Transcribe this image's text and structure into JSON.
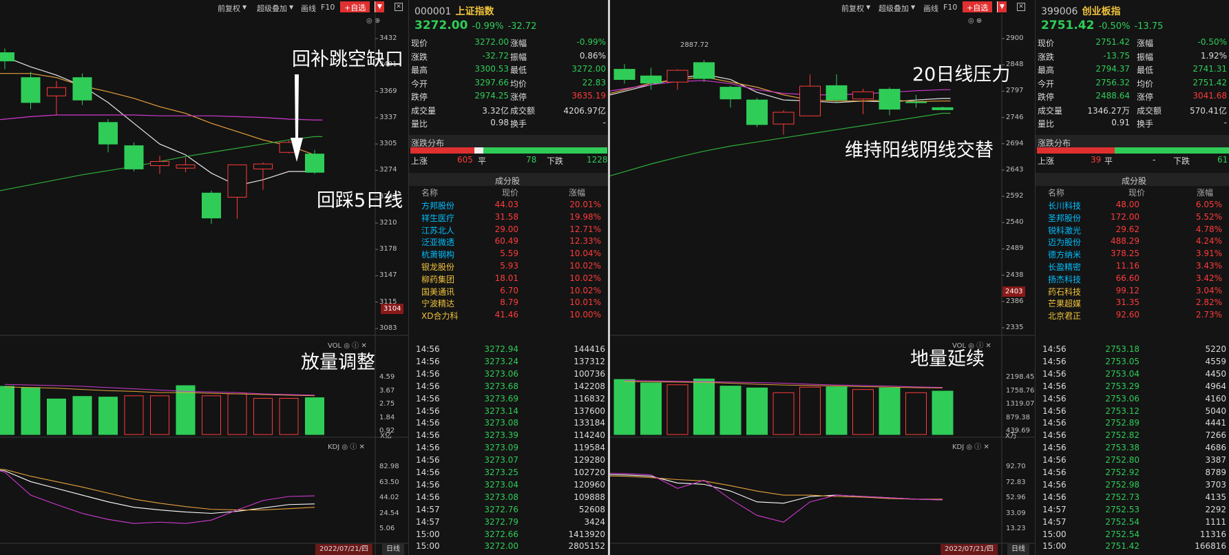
{
  "left": {
    "toolbar": {
      "adjust": "前复权",
      "overlay": "超级叠加",
      "draw": "画线",
      "f10": "F10",
      "fav": "+自选"
    },
    "price_axis": [
      "3432",
      "3401",
      "3369",
      "3337",
      "3305",
      "3274",
      "3242",
      "3210",
      "3178",
      "3147",
      "3115",
      "3083"
    ],
    "current_price_label": "3104",
    "vol_label": "VOL",
    "vol_axis": [
      "4.59",
      "3.67",
      "2.75",
      "1.84",
      "0.92"
    ],
    "vol_unit": "X亿",
    "kdj_label": "KDJ",
    "kdj_axis": [
      "82.98",
      "63.50",
      "44.02",
      "24.54",
      "5.06"
    ],
    "date": "2022/07/21/四",
    "period": "日线",
    "annotations": {
      "gap": "回补跳空缺口",
      "ma5": "回踩5日线",
      "vol": "放量调整"
    },
    "candles": [
      {
        "o": 3415,
        "c": 3405,
        "h": 3420,
        "l": 3395
      },
      {
        "o": 3385,
        "c": 3355,
        "h": 3392,
        "l": 3347
      },
      {
        "o": 3363,
        "c": 3373,
        "h": 3381,
        "l": 3340
      },
      {
        "o": 3385,
        "c": 3358,
        "h": 3390,
        "l": 3352
      },
      {
        "o": 3331,
        "c": 3305,
        "h": 3335,
        "l": 3295
      },
      {
        "o": 3303,
        "c": 3275,
        "h": 3307,
        "l": 3272
      },
      {
        "o": 3279,
        "c": 3284,
        "h": 3291,
        "l": 3269
      },
      {
        "o": 3276,
        "c": 3280,
        "h": 3289,
        "l": 3271
      },
      {
        "o": 3246,
        "c": 3216,
        "h": 3249,
        "l": 3209
      },
      {
        "o": 3241,
        "c": 3280,
        "h": 3280,
        "l": 3215
      },
      {
        "o": 3275,
        "c": 3281,
        "h": 3283,
        "l": 3250
      },
      {
        "o": 3295,
        "c": 3307,
        "h": 3309,
        "l": 3294
      },
      {
        "o": 3293,
        "c": 3271,
        "h": 3298,
        "l": 3269
      }
    ],
    "ma": {
      "ma5": [
        3410,
        3398,
        3388,
        3375,
        3355,
        3330,
        3305,
        3292,
        3270,
        3255,
        3262,
        3272,
        3272
      ],
      "ma10": [
        3390,
        3390,
        3385,
        3375,
        3368,
        3360,
        3350,
        3342,
        3330,
        3320,
        3310,
        3303,
        3292
      ],
      "ma20": [
        3335,
        3338,
        3340,
        3340,
        3340,
        3340,
        3339,
        3339,
        3339,
        3338,
        3337,
        3335,
        3334
      ],
      "ma60": [
        3250,
        3256,
        3262,
        3268,
        3273,
        3278,
        3284,
        3290,
        3295,
        3300,
        3305,
        3310,
        3314
      ]
    },
    "volume": {
      "bars": [
        {
          "v": 3.8,
          "up": false
        },
        {
          "v": 3.7,
          "up": false
        },
        {
          "v": 2.8,
          "up": false
        },
        {
          "v": 3.0,
          "up": false
        },
        {
          "v": 2.95,
          "up": false
        },
        {
          "v": 3.05,
          "up": true
        },
        {
          "v": 3.05,
          "up": true
        },
        {
          "v": 3.85,
          "up": false
        },
        {
          "v": 3.05,
          "up": true
        },
        {
          "v": 3.2,
          "up": true
        },
        {
          "v": 2.85,
          "up": true
        },
        {
          "v": 2.85,
          "up": true
        },
        {
          "v": 2.9,
          "up": false
        }
      ],
      "ma1": [
        3.75,
        3.7,
        3.65,
        3.55,
        3.45,
        3.4,
        3.3,
        3.3,
        3.25,
        3.2,
        3.15,
        3.1,
        3.05
      ],
      "ma2": [
        3.95,
        3.9,
        3.85,
        3.8,
        3.7,
        3.6,
        3.5,
        3.4,
        3.35,
        3.3,
        3.2,
        3.15,
        3.1
      ]
    },
    "kdj": {
      "k": [
        88,
        72,
        62,
        52,
        42,
        34,
        30,
        27,
        25,
        28,
        33,
        38,
        39
      ],
      "d": [
        90,
        80,
        72,
        64,
        55,
        46,
        40,
        35,
        31,
        30,
        30,
        32,
        34
      ],
      "j": [
        86,
        52,
        38,
        25,
        16,
        10,
        12,
        10,
        15,
        30,
        44,
        50,
        51
      ]
    }
  },
  "info1": {
    "code": "000001",
    "name": "上证指数",
    "price": "3272.00",
    "pct": "-0.99%",
    "chg": "-32.72",
    "rows": [
      [
        "现价",
        "3272.00",
        "涨幅",
        "-0.99%"
      ],
      [
        "涨跌",
        "-32.72",
        "振幅",
        "0.86%"
      ],
      [
        "最高",
        "3300.53",
        "最低",
        "3272.00"
      ],
      [
        "今开",
        "3297.66",
        "均价",
        "22.83"
      ],
      [
        "跌停",
        "2974.25",
        "涨停",
        "3635.19"
      ],
      [
        "成交量",
        "3.32亿",
        "成交额",
        "4206.97亿"
      ],
      [
        "量比",
        "0.98",
        "换手",
        "-"
      ]
    ],
    "dist_title": "涨跌分布",
    "up_label": "上涨",
    "up": "605",
    "flat_label": "平",
    "flat": "78",
    "down_label": "下跌",
    "down": "1228",
    "comp_title": "成分股",
    "comp_headers": [
      "名称",
      "现价",
      "涨幅"
    ],
    "comps": [
      [
        "方邦股份",
        "44.03",
        "20.01%"
      ],
      [
        "祥生医疗",
        "31.58",
        "19.98%"
      ],
      [
        "江苏北人",
        "29.00",
        "12.71%"
      ],
      [
        "泛亚微透",
        "60.49",
        "12.33%"
      ],
      [
        "杭萧钢构",
        "5.59",
        "10.04%"
      ],
      [
        "银龙股份",
        "5.93",
        "10.02%"
      ],
      [
        "柳药集团",
        "18.01",
        "10.02%"
      ],
      [
        "国美通讯",
        "6.70",
        "10.02%"
      ],
      [
        "宁波精达",
        "8.79",
        "10.01%"
      ],
      [
        "XD合力科",
        "41.46",
        "10.00%"
      ]
    ],
    "trades": [
      [
        "14:56",
        "3272.94",
        "144416"
      ],
      [
        "14:56",
        "3273.24",
        "137312"
      ],
      [
        "14:56",
        "3273.06",
        "100736"
      ],
      [
        "14:56",
        "3273.68",
        "142208"
      ],
      [
        "14:56",
        "3273.69",
        "116832"
      ],
      [
        "14:56",
        "3273.14",
        "137600"
      ],
      [
        "14:56",
        "3273.08",
        "133184"
      ],
      [
        "14:56",
        "3273.39",
        "114240"
      ],
      [
        "14:56",
        "3273.09",
        "119584"
      ],
      [
        "14:56",
        "3273.07",
        "129280"
      ],
      [
        "14:56",
        "3273.25",
        "102720"
      ],
      [
        "14:56",
        "3273.04",
        "120960"
      ],
      [
        "14:56",
        "3273.08",
        "109888"
      ],
      [
        "14:57",
        "3272.76",
        "52608"
      ],
      [
        "14:57",
        "3272.79",
        "3424"
      ],
      [
        "15:00",
        "3272.66",
        "1413920"
      ],
      [
        "15:00",
        "3272.00",
        "2805152"
      ]
    ]
  },
  "right": {
    "toolbar": {
      "adjust": "前复权",
      "overlay": "超级叠加",
      "draw": "画线",
      "f10": "F10",
      "fav": "+自选"
    },
    "price_axis": [
      "2900",
      "2848",
      "2797",
      "2746",
      "2694",
      "2643",
      "2592",
      "2540",
      "2489",
      "2438",
      "2386",
      "2335"
    ],
    "current_price_label": "2403",
    "high_label": "2887.72",
    "vol_label": "VOL",
    "vol_axis": [
      "2198.45",
      "1758.76",
      "1319.07",
      "879.38",
      "439.69"
    ],
    "vol_unit": "X万",
    "kdj_label": "KDJ",
    "kdj_axis": [
      "92.70",
      "72.83",
      "52.96",
      "33.09",
      "13.23"
    ],
    "date": "2022/07/21/四",
    "period": "日线",
    "annotations": {
      "ma20": "20日线压力",
      "alt": "维持阳线阴线交替",
      "vol": "地量延续"
    },
    "candles": [
      {
        "o": 2840,
        "c": 2820,
        "h": 2850,
        "l": 2812
      },
      {
        "o": 2827,
        "c": 2813,
        "h": 2843,
        "l": 2800
      },
      {
        "o": 2815,
        "c": 2838,
        "h": 2840,
        "l": 2800
      },
      {
        "o": 2853,
        "c": 2822,
        "h": 2858,
        "l": 2815
      },
      {
        "o": 2805,
        "c": 2782,
        "h": 2808,
        "l": 2765
      },
      {
        "o": 2780,
        "c": 2732,
        "h": 2784,
        "l": 2727
      },
      {
        "o": 2733,
        "c": 2756,
        "h": 2760,
        "l": 2712
      },
      {
        "o": 2749,
        "c": 2807,
        "h": 2830,
        "l": 2748
      },
      {
        "o": 2808,
        "c": 2780,
        "h": 2830,
        "l": 2775
      },
      {
        "o": 2782,
        "c": 2796,
        "h": 2802,
        "l": 2752
      },
      {
        "o": 2801,
        "c": 2762,
        "h": 2805,
        "l": 2750
      },
      {
        "o": 2776,
        "c": 2775,
        "h": 2790,
        "l": 2765
      },
      {
        "o": 2765,
        "c": 2761,
        "h": 2767,
        "l": 2760
      }
    ],
    "ma": {
      "ma5": [
        2797,
        2810,
        2822,
        2830,
        2820,
        2795,
        2780,
        2778,
        2775,
        2778,
        2776,
        2780,
        2783
      ],
      "ma10": [
        2800,
        2813,
        2820,
        2825,
        2815,
        2805,
        2790,
        2780,
        2778,
        2778,
        2780,
        2777,
        2778
      ],
      "ma20": [
        2802,
        2810,
        2816,
        2818,
        2812,
        2800,
        2793,
        2790,
        2790,
        2792,
        2795,
        2798,
        2800
      ],
      "ma60": [
        2640,
        2655,
        2668,
        2680,
        2690,
        2698,
        2706,
        2714,
        2722,
        2730,
        2738,
        2746,
        2754
      ]
    },
    "volume": {
      "bars": [
        {
          "v": 2080,
          "up": false
        },
        {
          "v": 1950,
          "up": false
        },
        {
          "v": 1880,
          "up": true
        },
        {
          "v": 2100,
          "up": false
        },
        {
          "v": 1830,
          "up": false
        },
        {
          "v": 1760,
          "up": false
        },
        {
          "v": 1580,
          "up": true
        },
        {
          "v": 1790,
          "up": true
        },
        {
          "v": 1800,
          "up": false
        },
        {
          "v": 1700,
          "up": true
        },
        {
          "v": 1760,
          "up": false
        },
        {
          "v": 1580,
          "up": true
        },
        {
          "v": 1640,
          "up": false
        }
      ],
      "ma1": [
        2000,
        1990,
        1980,
        1970,
        1940,
        1900,
        1870,
        1850,
        1830,
        1810,
        1790,
        1770,
        1760
      ],
      "ma2": [
        2040,
        2030,
        2010,
        1995,
        1980,
        1960,
        1940,
        1900,
        1870,
        1850,
        1830,
        1800,
        1780
      ]
    },
    "kdj": {
      "k": [
        82,
        80,
        70,
        68,
        58,
        42,
        40,
        50,
        52,
        50,
        48,
        46,
        45
      ],
      "d": [
        80,
        78,
        75,
        73,
        66,
        58,
        52,
        52,
        50,
        49,
        47,
        46,
        46
      ],
      "j": [
        84,
        82,
        62,
        74,
        46,
        22,
        12,
        42,
        52,
        50,
        48,
        46,
        45
      ]
    }
  },
  "info2": {
    "code": "399006",
    "name": "创业板指",
    "price": "2751.42",
    "pct": "-0.50%",
    "chg": "-13.75",
    "rows": [
      [
        "现价",
        "2751.42",
        "涨幅",
        "-0.50%"
      ],
      [
        "涨跌",
        "-13.75",
        "振幅",
        "1.92%"
      ],
      [
        "最高",
        "2794.37",
        "最低",
        "2741.31"
      ],
      [
        "今开",
        "2756.32",
        "均价",
        "2751.42"
      ],
      [
        "跌停",
        "2488.64",
        "涨停",
        "3041.68"
      ],
      [
        "成交量",
        "1346.27万",
        "成交额",
        "570.41亿"
      ],
      [
        "量比",
        "0.91",
        "换手",
        "-"
      ]
    ],
    "dist_title": "涨跌分布",
    "up_label": "上涨",
    "up": "39",
    "flat_label": "平",
    "flat": "-",
    "down_label": "下跌",
    "down": "61",
    "comp_title": "成分股",
    "comp_headers": [
      "名称",
      "现价",
      "涨幅"
    ],
    "comps": [
      [
        "长川科技",
        "48.00",
        "6.05%"
      ],
      [
        "圣邦股份",
        "172.00",
        "5.52%"
      ],
      [
        "锐科激光",
        "29.62",
        "4.78%"
      ],
      [
        "迈为股份",
        "488.29",
        "4.24%"
      ],
      [
        "德方纳米",
        "378.25",
        "3.91%"
      ],
      [
        "长盈精密",
        "11.16",
        "3.43%"
      ],
      [
        "扬杰科技",
        "66.60",
        "3.42%"
      ],
      [
        "药石科技",
        "99.12",
        "3.04%"
      ],
      [
        "芒果超媒",
        "31.35",
        "2.82%"
      ],
      [
        "北京君正",
        "92.60",
        "2.73%"
      ]
    ],
    "trades": [
      [
        "14:56",
        "2753.18",
        "5220"
      ],
      [
        "14:56",
        "2753.05",
        "4559"
      ],
      [
        "14:56",
        "2753.04",
        "4450"
      ],
      [
        "14:56",
        "2753.29",
        "4964"
      ],
      [
        "14:56",
        "2753.06",
        "4160"
      ],
      [
        "14:56",
        "2753.12",
        "5040"
      ],
      [
        "14:56",
        "2752.89",
        "4441"
      ],
      [
        "14:56",
        "2752.82",
        "7266"
      ],
      [
        "14:56",
        "2753.38",
        "4686"
      ],
      [
        "14:56",
        "2752.80",
        "3387"
      ],
      [
        "14:56",
        "2752.92",
        "8789"
      ],
      [
        "14:56",
        "2752.98",
        "3703"
      ],
      [
        "14:56",
        "2752.73",
        "4135"
      ],
      [
        "14:57",
        "2752.53",
        "2292"
      ],
      [
        "14:57",
        "2752.54",
        "1111"
      ],
      [
        "15:00",
        "2752.54",
        "11316"
      ],
      [
        "15:00",
        "2751.42",
        "166816"
      ]
    ]
  }
}
